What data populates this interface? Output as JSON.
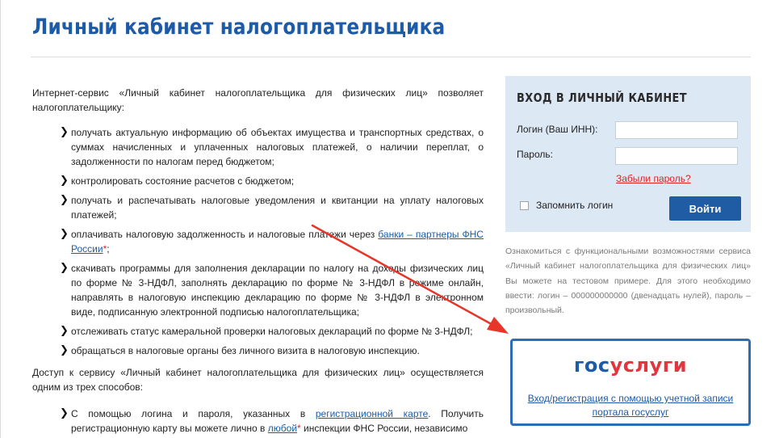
{
  "page": {
    "title": "Личный кабинет налогоплательщика"
  },
  "content": {
    "intro": "Интернет-сервис «Личный кабинет налогоплательщика для физических лиц» позволяет налогоплательщику:",
    "features": [
      "получать актуальную информацию об объектах имущества и транспортных средствах, о суммах начисленных и уплаченных налоговых платежей, о наличии переплат, о задолженности по налогам перед бюджетом;",
      "контролировать состояние расчетов с бюджетом;",
      "получать и распечатывать налоговые уведомления и квитанции на уплату налоговых платежей;",
      {
        "before": "оплачивать налоговую задолженность и налоговые платежи через ",
        "link": "банки – партнеры ФНС России",
        "asterisk": "*",
        "after": ";"
      },
      "скачивать программы для заполнения декларации по налогу на доходы физических лиц по форме № 3-НДФЛ, заполнять декларацию по форме № 3-НДФЛ в режиме онлайн, направлять в налоговую инспекцию декларацию по форме № 3-НДФЛ в электронном виде, подписанную электронной подписью налогоплательщика;",
      "отслеживать статус камеральной проверки налоговых деклараций по форме № 3-НДФЛ;",
      "обращаться в налоговые органы без личного визита в налоговую инспекцию."
    ],
    "access_text": "Доступ к сервису «Личный кабинет налогоплательщика для физических лиц» осуществляется одним из трех способов:",
    "method_1": {
      "before": "С помощью логина и пароля, указанных в ",
      "link": "регистрационной карте",
      "middle": ". Получить регистрационную карту вы можете лично в ",
      "link2": "любой",
      "asterisk": "*",
      "after": " инспекции ФНС России, независимо"
    }
  },
  "login": {
    "title": "ВХОД В ЛИЧНЫЙ КАБИНЕТ",
    "login_label": "Логин (Ваш ИНН):",
    "login_value": "",
    "password_label": "Пароль:",
    "password_value": "",
    "forgot_link": "Забыли пароль?",
    "remember_label": "Запомнить логин",
    "remember_checked": false,
    "submit_label": "Войти"
  },
  "demo_note": "Ознакомиться с функциональными возможностями сервиса «Личный кабинет налогоплательщика для физических лиц» Вы можете на тестовом примере. Для этого необходимо ввести: логин – 000000000000 (двенадцать нулей), пароль – произвольный.",
  "gosuslugi": {
    "logo_part1": "гос",
    "logo_part2": "услуги",
    "link_text": "Вход/регистрация с помощью учетной записи портала госуслуг"
  },
  "colors": {
    "brand_blue": "#1d5ba8",
    "button_blue": "#1f5ca4",
    "login_panel_bg": "#dde8f5",
    "accent_red": "#e4353f",
    "annotation_arrow": "#e8352a"
  },
  "icons": {
    "bullet": "chevron-right-icon",
    "arrow": "annotation-arrow-icon"
  }
}
